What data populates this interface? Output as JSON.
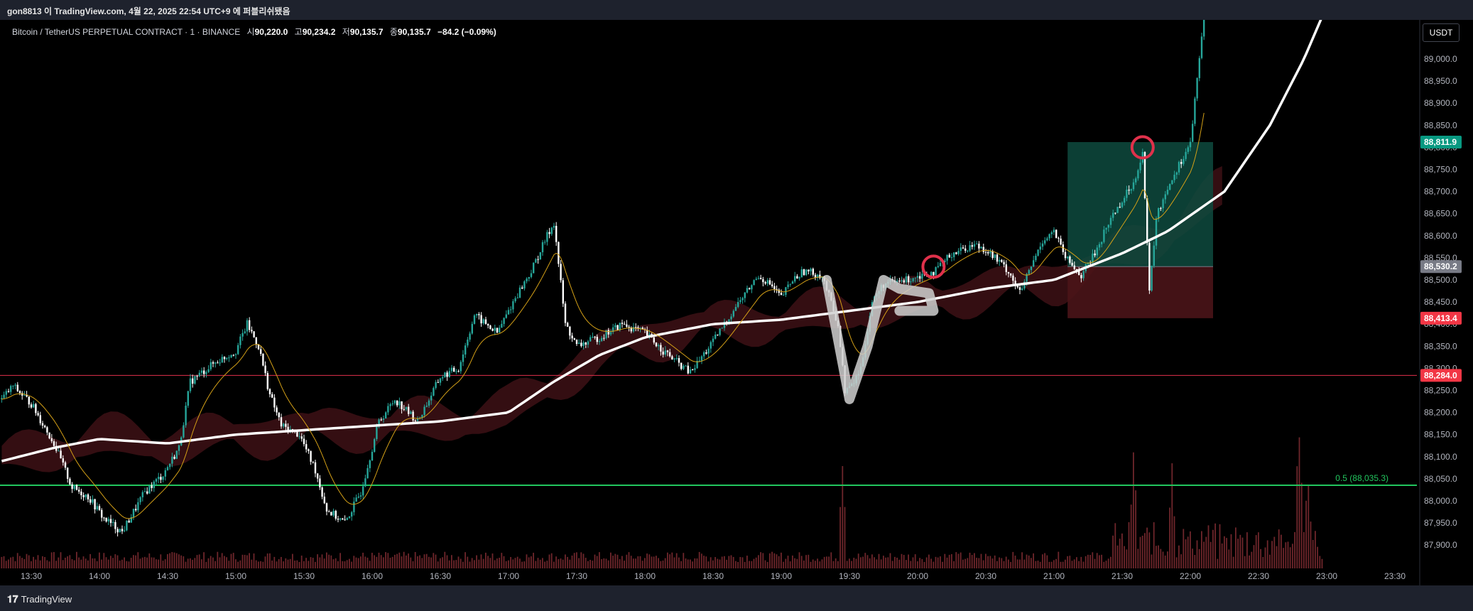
{
  "header": {
    "published_text": "gon8813 이 TradingView.com, 4월 22, 2025 22:54 UTC+9 에 퍼블리쉬됐음"
  },
  "legend": {
    "symbol": "Bitcoin / TetherUS PERPETUAL CONTRACT · 1 · BINANCE",
    "open_label": "시",
    "open": "90,220.0",
    "high_label": "고",
    "high": "90,234.2",
    "low_label": "저",
    "low": "90,135.7",
    "close_label": "종",
    "close": "90,135.7",
    "change": "−84.2 (−0.09%)"
  },
  "toolbar": {
    "currency": "USDT"
  },
  "footer": {
    "brand": "TradingView"
  },
  "colors": {
    "up": "#26a69a",
    "down": "#ffffff",
    "cloud": "#3a1014",
    "ma_slow": "#ffffff",
    "ma_fast": "#d4a017",
    "annotation_red": "#e0314b",
    "long_profit": "#0e4a3e",
    "long_risk": "#4a1418",
    "fib": "#22c55e"
  },
  "chart_data": {
    "type": "candlestick",
    "title": "",
    "symbol": "BTCUSDT.P",
    "interval": "1",
    "x_tick_labels": [
      "13:30",
      "14:00",
      "14:30",
      "15:00",
      "15:30",
      "16:00",
      "16:30",
      "17:00",
      "17:30",
      "18:00",
      "18:30",
      "19:00",
      "19:30",
      "20:00",
      "20:30",
      "21:00",
      "21:30",
      "22:00",
      "22:30",
      "23:00",
      "23:30"
    ],
    "y_tick_labels": [
      "89,000.0",
      "88,950.0",
      "88,900.0",
      "88,850.0",
      "88,800.0",
      "88,750.0",
      "88,700.0",
      "88,650.0",
      "88,600.0",
      "88,550.0",
      "88,500.0",
      "88,450.0",
      "88,400.0",
      "88,350.0",
      "88,300.0",
      "88,250.0",
      "88,200.0",
      "88,150.0",
      "88,100.0",
      "88,050.0",
      "88,000.0",
      "87,950.0",
      "87,900.0"
    ],
    "ylim": [
      87880,
      89100
    ],
    "price_path": [
      [
        "13:17",
        88230
      ],
      [
        "13:22",
        88260
      ],
      [
        "13:30",
        88220
      ],
      [
        "13:40",
        88130
      ],
      [
        "13:48",
        88030
      ],
      [
        "13:55",
        88010
      ],
      [
        "14:02",
        87960
      ],
      [
        "14:10",
        87930
      ],
      [
        "14:20",
        88020
      ],
      [
        "14:28",
        88060
      ],
      [
        "14:35",
        88120
      ],
      [
        "14:40",
        88270
      ],
      [
        "14:50",
        88310
      ],
      [
        "15:00",
        88340
      ],
      [
        "15:05",
        88400
      ],
      [
        "15:10",
        88350
      ],
      [
        "15:15",
        88240
      ],
      [
        "15:20",
        88170
      ],
      [
        "15:28",
        88150
      ],
      [
        "15:35",
        88070
      ],
      [
        "15:40",
        87980
      ],
      [
        "15:48",
        87950
      ],
      [
        "15:55",
        88020
      ],
      [
        "16:03",
        88180
      ],
      [
        "16:10",
        88230
      ],
      [
        "16:20",
        88180
      ],
      [
        "16:30",
        88280
      ],
      [
        "16:38",
        88300
      ],
      [
        "16:45",
        88420
      ],
      [
        "16:55",
        88380
      ],
      [
        "17:03",
        88460
      ],
      [
        "17:10",
        88520
      ],
      [
        "17:17",
        88600
      ],
      [
        "17:20",
        88630
      ],
      [
        "17:25",
        88400
      ],
      [
        "17:30",
        88350
      ],
      [
        "17:40",
        88370
      ],
      [
        "17:50",
        88400
      ],
      [
        "18:00",
        88380
      ],
      [
        "18:08",
        88340
      ],
      [
        "18:15",
        88310
      ],
      [
        "18:20",
        88290
      ],
      [
        "18:30",
        88360
      ],
      [
        "18:40",
        88440
      ],
      [
        "18:50",
        88510
      ],
      [
        "18:55",
        88490
      ],
      [
        "19:00",
        88460
      ],
      [
        "19:05",
        88500
      ],
      [
        "19:10",
        88520
      ],
      [
        "19:18",
        88510
      ],
      [
        "19:25",
        88400
      ],
      [
        "19:28",
        88250
      ],
      [
        "19:31",
        88260
      ],
      [
        "19:35",
        88300
      ],
      [
        "19:40",
        88450
      ],
      [
        "19:45",
        88490
      ],
      [
        "19:55",
        88500
      ],
      [
        "20:00",
        88510
      ],
      [
        "20:08",
        88520
      ],
      [
        "20:15",
        88560
      ],
      [
        "20:25",
        88580
      ],
      [
        "20:30",
        88570
      ],
      [
        "20:40",
        88520
      ],
      [
        "20:45",
        88470
      ],
      [
        "20:55",
        88590
      ],
      [
        "21:00",
        88610
      ],
      [
        "21:05",
        88550
      ],
      [
        "21:12",
        88510
      ],
      [
        "21:18",
        88560
      ],
      [
        "21:25",
        88640
      ],
      [
        "21:35",
        88720
      ],
      [
        "21:39",
        88790
      ],
      [
        "21:42",
        88470
      ],
      [
        "21:45",
        88640
      ],
      [
        "21:50",
        88710
      ],
      [
        "21:55",
        88760
      ],
      [
        "22:00",
        88810
      ],
      [
        "22:03",
        88950
      ],
      [
        "22:06",
        89100
      ]
    ],
    "moving_average_slow": [
      [
        "13:17",
        88090
      ],
      [
        "13:40",
        88120
      ],
      [
        "14:00",
        88140
      ],
      [
        "14:30",
        88130
      ],
      [
        "15:00",
        88150
      ],
      [
        "15:30",
        88160
      ],
      [
        "16:00",
        88170
      ],
      [
        "16:30",
        88180
      ],
      [
        "17:00",
        88200
      ],
      [
        "17:20",
        88270
      ],
      [
        "17:40",
        88330
      ],
      [
        "18:00",
        88370
      ],
      [
        "18:30",
        88400
      ],
      [
        "19:00",
        88410
      ],
      [
        "19:30",
        88430
      ],
      [
        "20:00",
        88450
      ],
      [
        "20:30",
        88480
      ],
      [
        "21:00",
        88500
      ],
      [
        "21:30",
        88560
      ],
      [
        "21:50",
        88610
      ],
      [
        "22:15",
        88700
      ],
      [
        "22:35",
        88850
      ],
      [
        "22:50",
        89000
      ],
      [
        "23:00",
        89120
      ]
    ],
    "horizontal_lines": [
      {
        "price": 88284.0,
        "label": "88,284.0",
        "color": "#e0314b"
      },
      {
        "price": 88035.3,
        "label": "0.5 (88,035.3)",
        "color": "#22c55e"
      }
    ],
    "price_labels": [
      {
        "price": 88811.9,
        "label": "88,811.9",
        "color": "#089981"
      },
      {
        "price": 88530.2,
        "label": "88,530.2",
        "color": "#787b86"
      },
      {
        "price": 88413.4,
        "label": "88,413.4",
        "color": "#f23645"
      },
      {
        "price": 88284.0,
        "label": "88,284.0",
        "color": "#f23645"
      }
    ],
    "long_position": {
      "start": "21:06",
      "end": "22:10",
      "entry": 88530.2,
      "target": 88811.9,
      "stop": 88413.4
    },
    "annotations": {
      "circles": [
        {
          "time": "20:07",
          "price": 88530
        },
        {
          "time": "21:39",
          "price": 88800
        }
      ],
      "drawn_path": [
        [
          "19:20",
          88500
        ],
        [
          "19:30",
          88230
        ],
        [
          "19:38",
          88350
        ],
        [
          "19:45",
          88500
        ],
        [
          "19:52",
          88480
        ],
        [
          "20:05",
          88470
        ],
        [
          "20:07",
          88430
        ],
        [
          "19:52",
          88430
        ]
      ]
    },
    "volume_spikes": [
      [
        "19:27",
        0.8
      ],
      [
        "21:35",
        0.7
      ],
      [
        "21:52",
        0.65
      ],
      [
        "22:48",
        1.0
      ],
      [
        "22:52",
        0.6
      ]
    ],
    "grid": false,
    "legend_position": "top-left"
  }
}
